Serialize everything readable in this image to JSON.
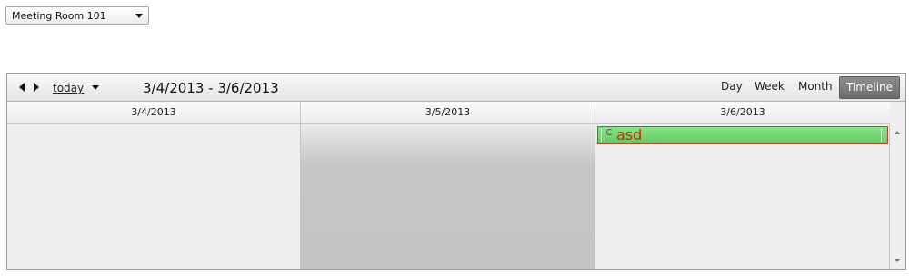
{
  "resource_selector": {
    "selected": "Meeting Room 101"
  },
  "toolbar": {
    "today_label": "today",
    "date_range": "3/4/2013 - 3/6/2013",
    "views": {
      "day": "Day",
      "week": "Week",
      "month": "Month",
      "timeline": "Timeline"
    },
    "active_view": "Timeline"
  },
  "days": [
    {
      "label": "3/4/2013"
    },
    {
      "label": "3/5/2013"
    },
    {
      "label": "3/6/2013"
    }
  ],
  "appointments": [
    {
      "subject": "asd",
      "day": "3/6/2013",
      "color": "#6fd56f",
      "border_color": "#b84a2a"
    }
  ],
  "icons": {
    "prev": "triangle-left",
    "next": "triangle-right",
    "dropdown": "triangle-down",
    "recurrence": "recurrence-icon",
    "scroll_up": "arrow-up",
    "scroll_down": "arrow-down"
  }
}
